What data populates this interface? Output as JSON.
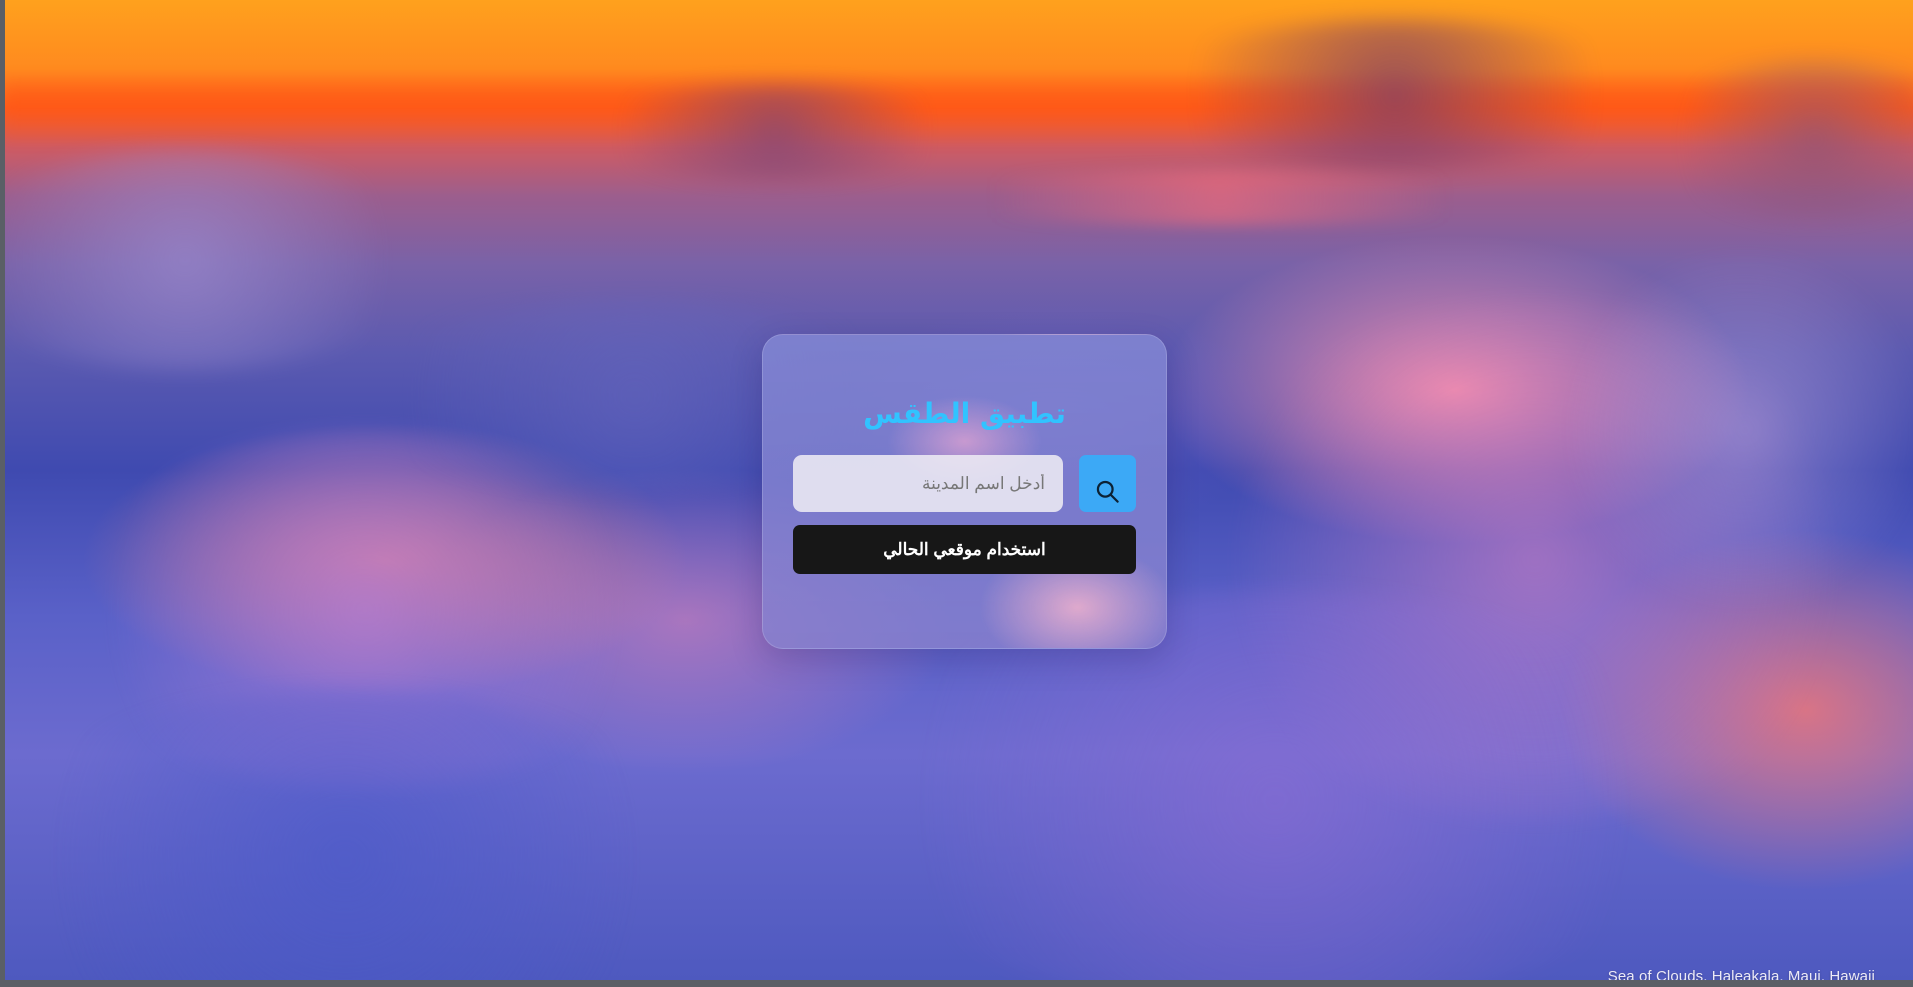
{
  "app": {
    "title": "تطبيق الطقس",
    "search": {
      "placeholder": "أدخل اسم المدينة",
      "value": "",
      "button_icon": "search-icon"
    },
    "location_button": {
      "label": "استخدام موقعي الحالي"
    }
  },
  "background": {
    "credit": "Sea of Clouds, Haleakala, Maui, Hawaii"
  },
  "colors": {
    "title": "#31c3ff",
    "search_button": "#3ca9f6",
    "location_button": "#171717"
  }
}
